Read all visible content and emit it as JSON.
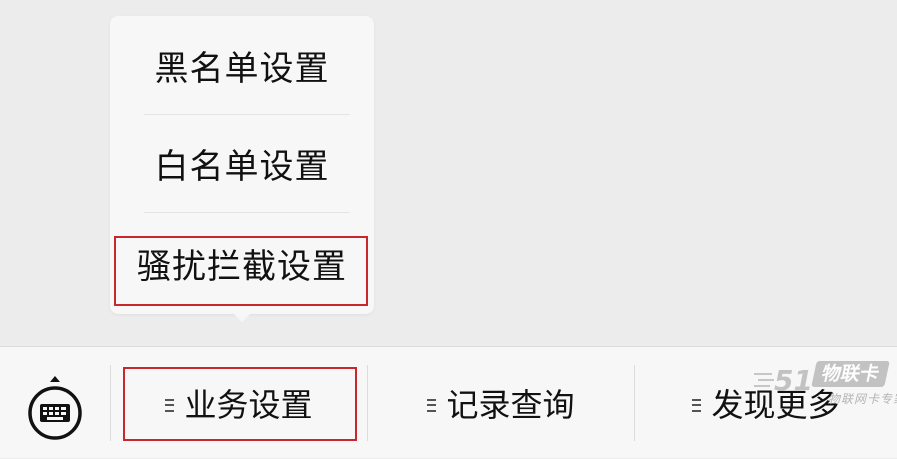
{
  "popup_menu": {
    "items": [
      {
        "label": "黑名单设置"
      },
      {
        "label": "白名单设置"
      },
      {
        "label": "骚扰拦截设置",
        "highlighted": true
      }
    ]
  },
  "bottom_bar": {
    "keyboard_icon": "keyboard-icon",
    "tabs": [
      {
        "label": "业务设置",
        "icon": "menu-lines-icon",
        "highlighted": true
      },
      {
        "label": "记录查询",
        "icon": "menu-lines-icon"
      },
      {
        "label": "发现更多",
        "icon": "menu-lines-icon"
      }
    ]
  },
  "watermark": {
    "logo_text": "51",
    "name": "物联卡",
    "subtitle": "物联网卡专家"
  },
  "colors": {
    "background": "#ececec",
    "panel": "#f7f7f7",
    "highlight": "#c8282d",
    "text": "#111111"
  }
}
